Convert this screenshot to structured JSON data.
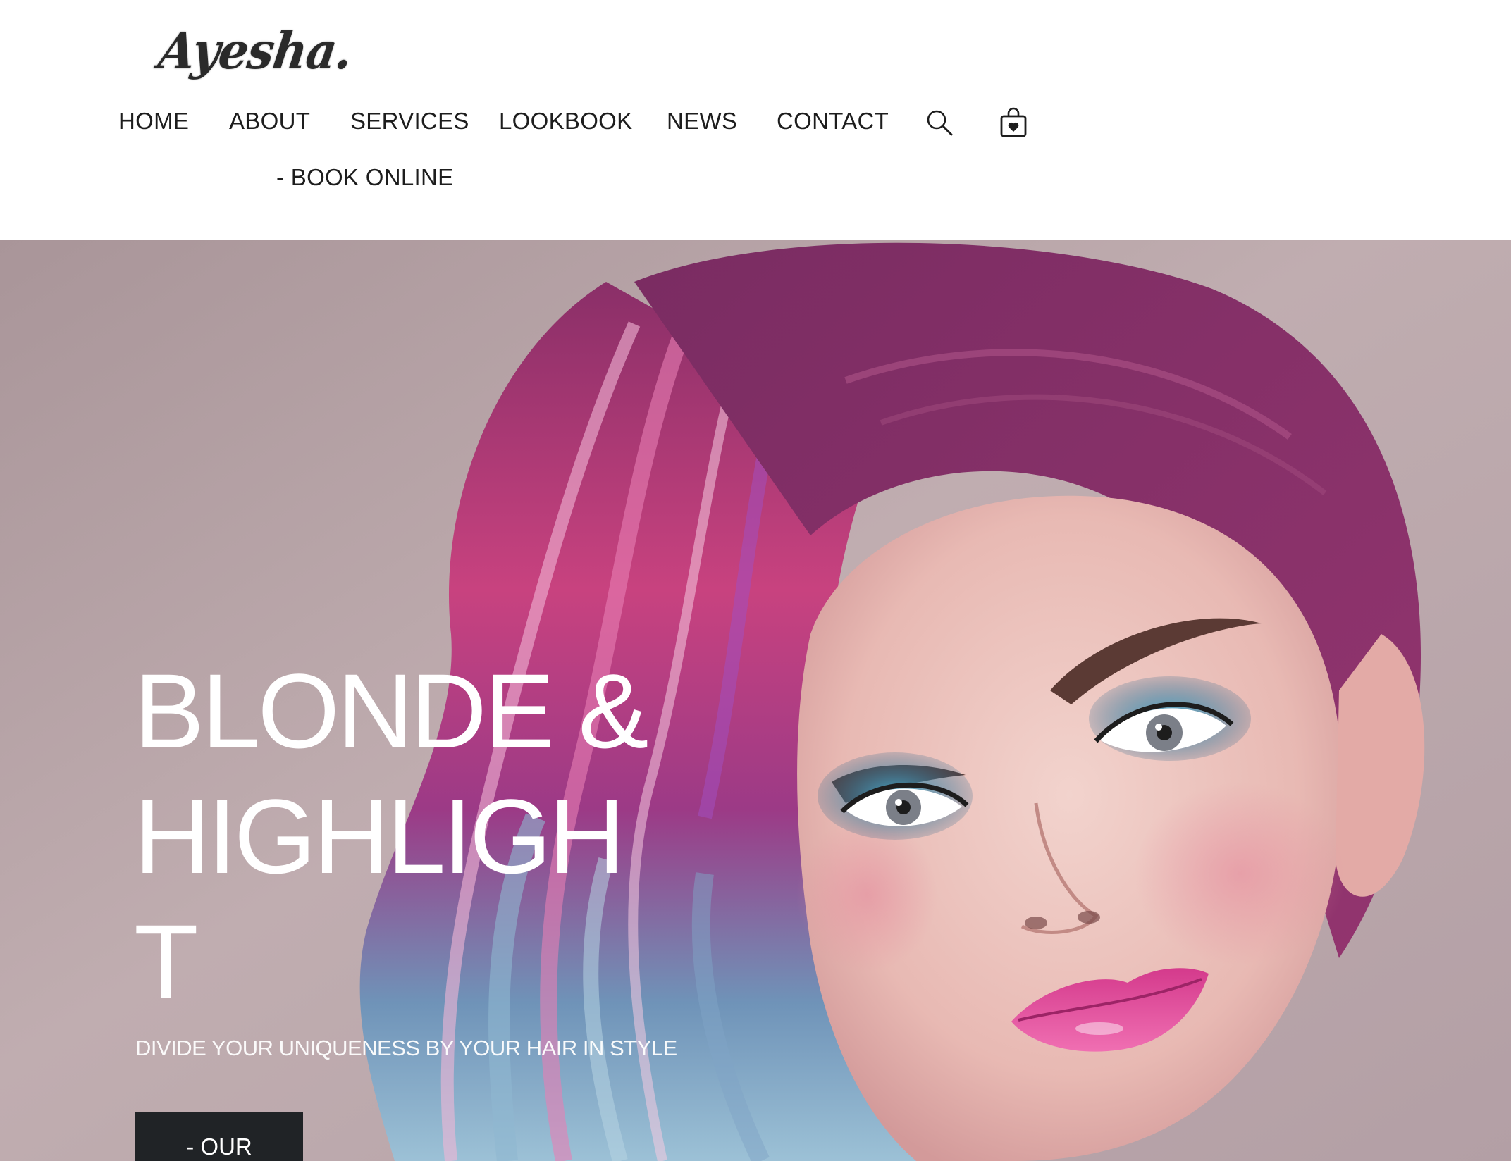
{
  "brand": {
    "logo_text": "Ayesha."
  },
  "nav": {
    "items": [
      {
        "label": "HOME"
      },
      {
        "label": "ABOUT"
      },
      {
        "label": "SERVICES"
      },
      {
        "label": "LOOKBOOK"
      },
      {
        "label": "NEWS"
      },
      {
        "label": "CONTACT"
      },
      {
        "label": "- BOOK ONLINE"
      }
    ],
    "icons": [
      "search-icon",
      "shopping-bag-icon"
    ]
  },
  "hero": {
    "title": "BLONDE & HIGHLIGHT",
    "subtitle": "DIVIDE YOUR UNIQUENESS BY YOUR HAIR IN STYLE",
    "button_label": "- OUR",
    "image_subject": "woman with pink, purple and blue dyed hair and teal eye makeup"
  },
  "colors": {
    "header_bg": "#ffffff",
    "nav_text": "#1d1d1d",
    "hero_text": "#ffffff",
    "button_bg": "#202326",
    "hero_backdrop": "#b7a5a9",
    "hair_pink": "#c8427f",
    "hair_purple": "#7a2a6a",
    "hair_blue": "#6f93b8",
    "lips": "#e0489a",
    "eyeshadow": "#2f8db5"
  }
}
